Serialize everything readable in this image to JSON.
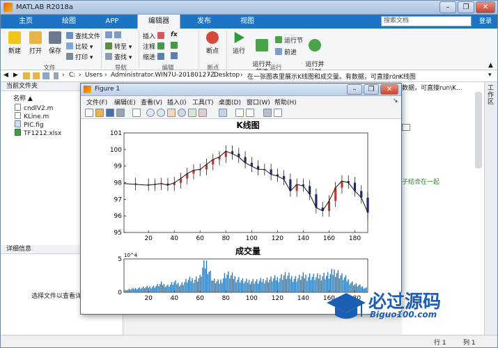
{
  "window": {
    "title": "MATLAB R2018a",
    "minimize": "–",
    "restore": "❐",
    "close": "✕"
  },
  "tabs": [
    {
      "label": "主页"
    },
    {
      "label": "绘图"
    },
    {
      "label": "APP"
    },
    {
      "label": "编辑器"
    },
    {
      "label": "发布"
    },
    {
      "label": "视图"
    }
  ],
  "search": {
    "placeholder": "搜索文档",
    "value": "搜索文档",
    "login": "登录"
  },
  "ribbon": {
    "file": {
      "new": "新建",
      "open": "打开",
      "save": "保存",
      "find_files": "查找文件",
      "compare": "比较",
      "print": "打印",
      "group": "文件"
    },
    "nav": {
      "goto": "转至",
      "find": "查找",
      "group": "导航"
    },
    "edit": {
      "insert": "插入",
      "comment": "注释",
      "indent": "缩进",
      "fx": "fx",
      "group": "编辑"
    },
    "breakpoints": {
      "label": "断点",
      "group": "断点"
    },
    "run": {
      "run": "运行",
      "run_advance": "运行并\n前进",
      "run_section": "运行节",
      "advance": "前进",
      "run_time": "运行并\n计时",
      "group": "运行"
    }
  },
  "address": {
    "parts": [
      "C:",
      "Users",
      "Administrator.WIN7U-20180127Z",
      "Desktop",
      "在一张图表里展示K线图和成交量。有数据，可直接run",
      "K线图"
    ]
  },
  "left_panel": {
    "header": "当前文件夹",
    "name_col": "名称",
    "files": [
      "cndlV2.m",
      "KLine.m",
      "PIC.fig",
      "TF1212.xlsx"
    ],
    "details_header": "详细信息",
    "details_hint": "选择文件以查看详细"
  },
  "right_panel": {
    "text1": "数据，可直接run\\K...",
    "text2": "子结合在一起",
    "label": "工作区"
  },
  "statusbar": {
    "row_label": "行",
    "row": "1",
    "col_label": "列",
    "col": "1"
  },
  "figure": {
    "title": "Figure 1",
    "menu": [
      "文件(F)",
      "编辑(E)",
      "查看(V)",
      "插入(I)",
      "工具(T)",
      "桌面(D)",
      "窗口(W)",
      "帮助(H)"
    ]
  },
  "watermark": {
    "brand": "必过源码",
    "site": "Biguo100.com"
  },
  "chart_data": [
    {
      "type": "line",
      "subtype": "candlestick",
      "title": "K线图",
      "xlim": [
        1,
        190
      ],
      "ylim": [
        95,
        101
      ],
      "xticks": [
        20,
        40,
        60,
        80,
        100,
        120,
        140,
        160,
        180
      ],
      "yticks": [
        95,
        96,
        97,
        98,
        99,
        100,
        101
      ],
      "x": [
        1,
        10,
        20,
        25,
        30,
        35,
        40,
        45,
        50,
        55,
        60,
        65,
        70,
        75,
        80,
        85,
        90,
        95,
        100,
        105,
        110,
        115,
        120,
        125,
        130,
        135,
        140,
        145,
        150,
        155,
        160,
        165,
        170,
        175,
        180,
        185,
        190
      ],
      "values": [
        97.95,
        97.9,
        97.85,
        97.9,
        97.95,
        97.85,
        98.0,
        98.25,
        98.55,
        98.75,
        98.8,
        99.1,
        99.4,
        99.55,
        99.9,
        99.75,
        99.55,
        99.2,
        99.0,
        98.8,
        98.8,
        98.5,
        98.4,
        98.2,
        97.5,
        97.9,
        97.8,
        97.3,
        96.5,
        96.3,
        96.9,
        97.7,
        98.1,
        98.0,
        97.5,
        97.1,
        96.2
      ],
      "colors": {
        "up": "#c0392b",
        "down": "#1f2a6b",
        "wick": "#000000"
      }
    },
    {
      "type": "bar",
      "title": "成交量",
      "xlim": [
        1,
        190
      ],
      "ylim": [
        0,
        5
      ],
      "y_exponent": "10^4",
      "xticks": [
        20,
        40,
        60,
        80,
        100,
        120,
        140,
        160,
        180
      ],
      "yticks": [
        0,
        5
      ],
      "x": [
        1,
        10,
        20,
        25,
        30,
        35,
        40,
        45,
        50,
        55,
        60,
        62,
        65,
        70,
        75,
        80,
        85,
        90,
        95,
        100,
        105,
        110,
        115,
        120,
        125,
        130,
        135,
        140,
        145,
        150,
        155,
        160,
        165,
        170,
        175,
        180,
        185,
        190
      ],
      "values": [
        0.3,
        0.6,
        0.8,
        0.9,
        1.3,
        1.0,
        1.5,
        1.2,
        1.8,
        2.0,
        2.2,
        3.6,
        4.4,
        1.8,
        1.5,
        2.8,
        2.4,
        2.0,
        1.6,
        1.8,
        1.6,
        1.9,
        2.0,
        2.1,
        2.6,
        2.3,
        2.1,
        2.4,
        2.5,
        2.2,
        2.6,
        2.5,
        3.3,
        2.4,
        1.8,
        1.2,
        0.9,
        0.6
      ],
      "color": "#2a7ab8"
    }
  ]
}
